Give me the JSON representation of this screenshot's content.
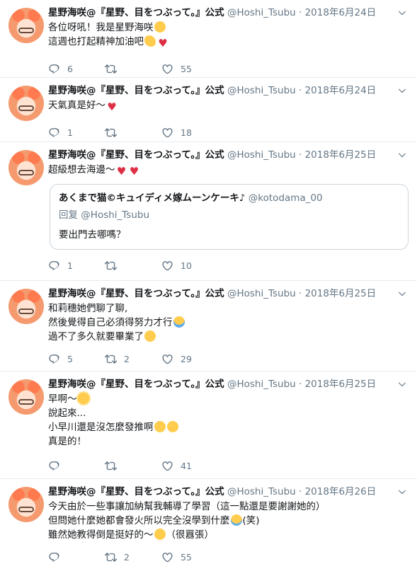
{
  "author": {
    "name": "星野海咲@『星野、目をつぶって。』公式",
    "handle": "@Hoshi_Tsubu"
  },
  "separator": "·",
  "tweets": [
    {
      "date": "2018年6月24日",
      "lines": [
        "各位呀吼！我是星野海咲",
        "這週也打起精神加油吧"
      ],
      "replies": "6",
      "retweets": "",
      "likes": "55"
    },
    {
      "date": "2018年6月24日",
      "lines": [
        "天氣真是好～"
      ],
      "replies": "1",
      "retweets": "",
      "likes": "18"
    },
    {
      "date": "2018年6月25日",
      "lines": [
        "超級想去海邊～"
      ],
      "quote": {
        "name": "あくまで猫©キュイディメ嫁ムーンケーキ♪",
        "handle": "@kotodama_00",
        "reply_to": "回复 @Hoshi_Tsubu",
        "text": "要出門去哪嗎？"
      },
      "replies": "1",
      "retweets": "",
      "likes": "10"
    },
    {
      "date": "2018年6月25日",
      "lines": [
        "和莉穗她們聊了聊,",
        "然後覺得自己必須得努力才行",
        "過不了多久就要畢業了"
      ],
      "replies": "5",
      "retweets": "2",
      "likes": "29"
    },
    {
      "date": "2018年6月25日",
      "lines": [
        "早啊～",
        "說起來...",
        "小早川還是沒怎麼發推啊",
        "真是的！"
      ],
      "replies": "",
      "retweets": "",
      "likes": "41"
    },
    {
      "date": "2018年6月26日",
      "lines": [
        "今天由於一些事讓加納幫我輔導了學習（這一點還是要謝謝她的）",
        "但問她什麼她都會發火所以完全沒學到什麼",
        "(笑)",
        "雖然她教得倒是挺好的～",
        "（很囂張）"
      ],
      "replies": "",
      "retweets": "2",
      "likes": "55"
    }
  ],
  "icons": {
    "reply": "reply-icon",
    "retweet": "retweet-icon",
    "like": "heart-icon",
    "more": "chevron-down-icon"
  },
  "colors": {
    "heart_emoji": "#dd2e44",
    "muted": "#657786",
    "border": "#e6ecf0"
  }
}
